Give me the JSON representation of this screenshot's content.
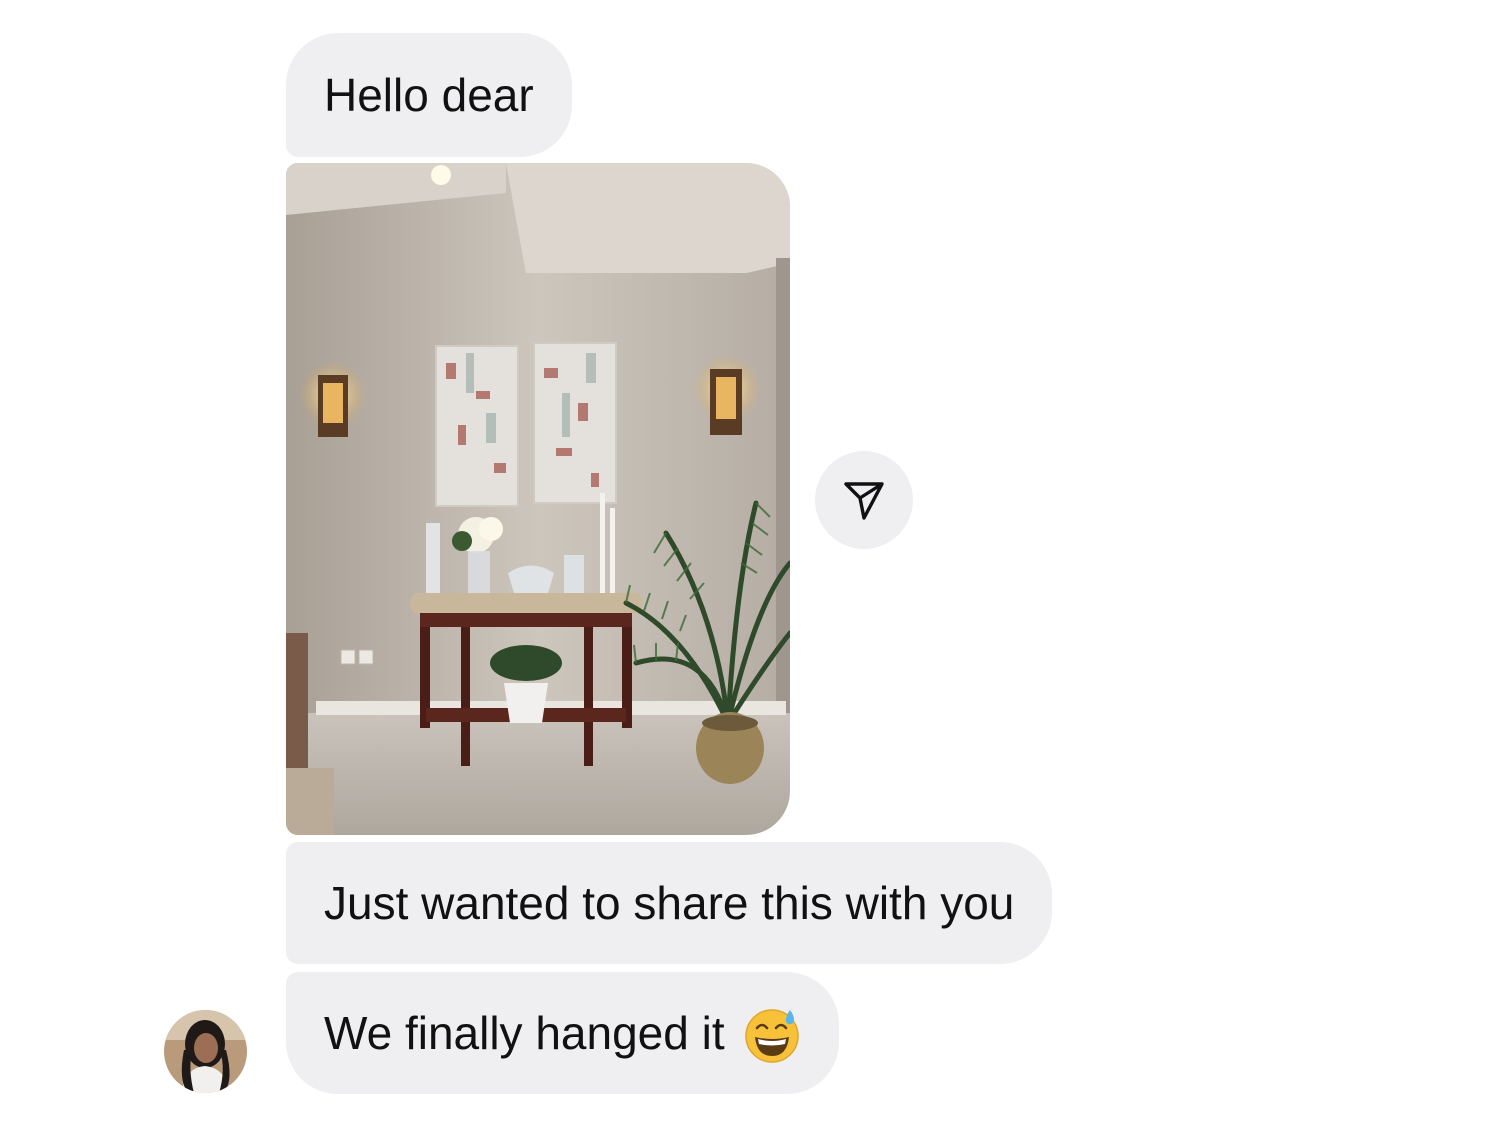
{
  "messages": [
    {
      "text": "Hello dear"
    },
    {
      "attachment": "photo"
    },
    {
      "text": "Just wanted to share this with you"
    },
    {
      "text": "We finally hanged it",
      "emoji": "grinning-face-with-sweat"
    }
  ],
  "share_icon": "paper-plane-icon",
  "avatar_icon": "user-avatar",
  "colors": {
    "bubble": "#efeff2",
    "text": "#111111",
    "background": "#ffffff"
  }
}
